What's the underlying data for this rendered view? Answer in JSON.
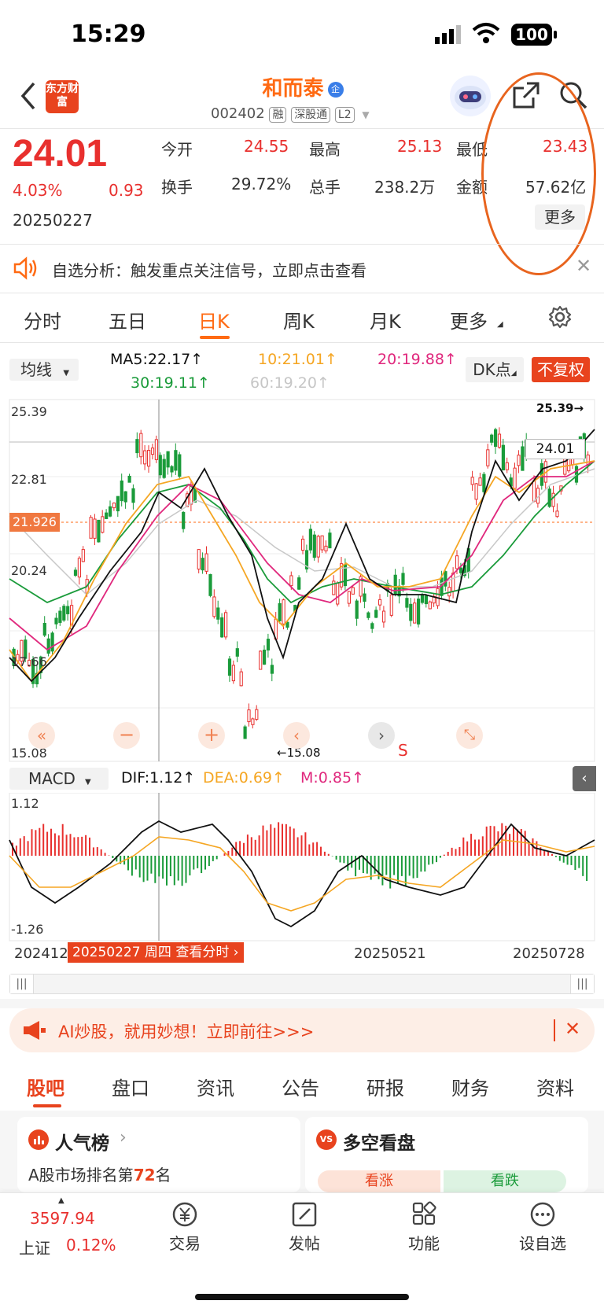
{
  "status_bar": {
    "time": "15:29",
    "battery": "100"
  },
  "header": {
    "broker_logo": "东方财富",
    "stock_name": "和而泰",
    "enterprise_badge": "企",
    "stock_code": "002402",
    "tags": [
      "融",
      "深股通",
      "L2"
    ]
  },
  "quote": {
    "price": "24.01",
    "change_pct": "4.03%",
    "change_amt": "0.93",
    "date": "20250227",
    "fields": [
      {
        "label": "今开",
        "value": "24.55",
        "color": "red"
      },
      {
        "label": "最高",
        "value": "25.13",
        "color": "red"
      },
      {
        "label": "最低",
        "value": "23.43",
        "color": "red"
      },
      {
        "label": "换手",
        "value": "29.72%",
        "color": "dark"
      },
      {
        "label": "总手",
        "value": "238.2万",
        "color": "dark"
      },
      {
        "label": "金额",
        "value": "57.62亿",
        "color": "dark"
      }
    ],
    "more_button": "更多"
  },
  "notice": {
    "text": "自选分析：触发重点关注信号，立即点击查看"
  },
  "period_tabs": [
    "分时",
    "五日",
    "日K",
    "周K",
    "月K",
    "更多"
  ],
  "active_period": "日K",
  "indicators": {
    "ma_select": "均线",
    "ma5": "MA5:22.17",
    "ma10": "10:21.01",
    "ma20": "20:19.88",
    "ma30": "30:19.11",
    "ma60": "60:19.20",
    "dk_button": "DK点",
    "fq_button": "不复权"
  },
  "kline": {
    "y_labels": [
      "25.39",
      "22.81",
      "20.24",
      "17.66",
      "15.08"
    ],
    "highlight_price": "21.926",
    "max_label": "25.39",
    "min_label": "15.08",
    "last_price": "24.01",
    "signal_s": "S"
  },
  "macd": {
    "select": "MACD",
    "dif": "DIF:1.12",
    "dea": "DEA:0.69",
    "m": "M:0.85",
    "top": "1.12",
    "bottom": "-1.26"
  },
  "x_labels": [
    "20241201",
    "20250521",
    "20250728"
  ],
  "crosshair_label": "20250227 周四 查看分时",
  "ad_banner": {
    "text": "AI炒股，就用妙想！立即前往>>>"
  },
  "content_tabs": [
    "股吧",
    "盘口",
    "资讯",
    "公告",
    "研报",
    "财务",
    "资料"
  ],
  "active_content_tab": "股吧",
  "cards": {
    "popular": {
      "title": "人气榜",
      "desc_prefix": "A股市场排名第",
      "rank": "72",
      "desc_suffix": "名"
    },
    "bull_bear": {
      "title": "多空看盘",
      "up": "看涨",
      "down": "看跌"
    }
  },
  "bottom_bar": {
    "index_value": "3597.94",
    "index_name": "上证",
    "index_change": "0.12%",
    "items": [
      "交易",
      "发帖",
      "功能",
      "设自选"
    ]
  },
  "colors": {
    "up": "#e8302e",
    "down": "#1a9b3a",
    "accent": "#ff6a13"
  }
}
